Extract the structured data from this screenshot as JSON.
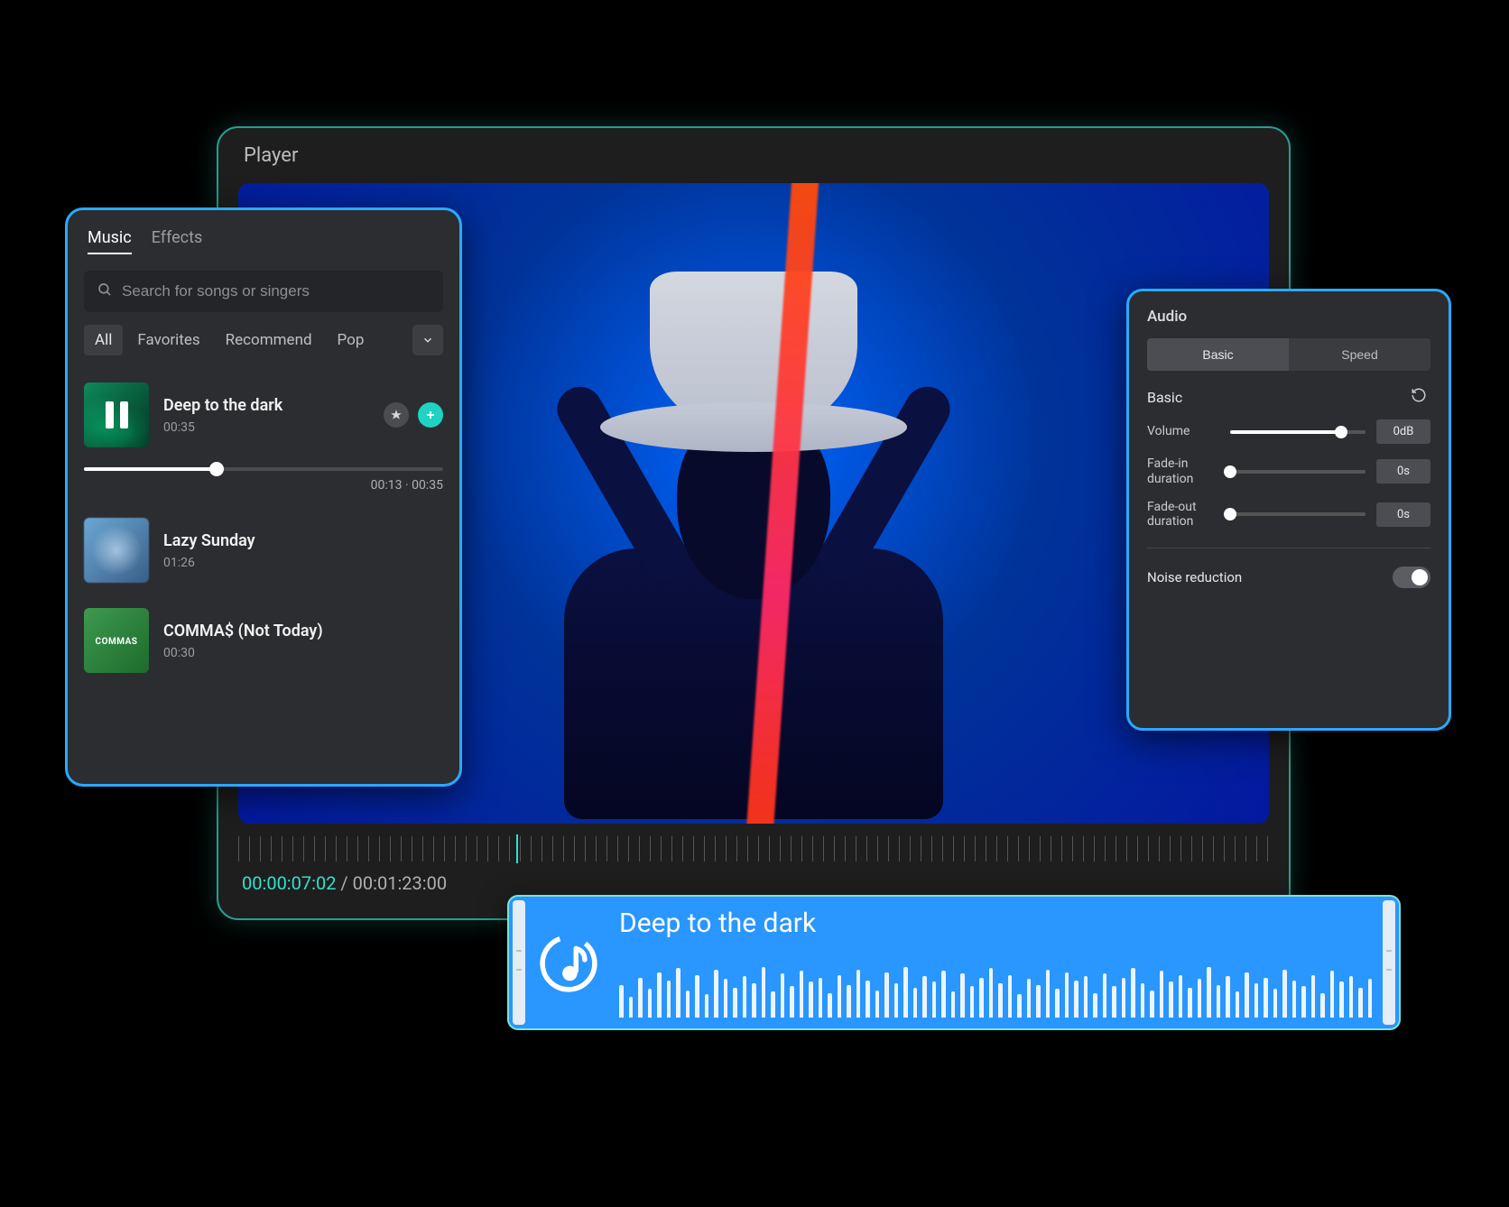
{
  "player": {
    "title": "Player",
    "timecode_current": "00:00:07:02",
    "timecode_total": "00:01:23:00",
    "timecode_sep": " / "
  },
  "musicPanel": {
    "tabs": {
      "music": "Music",
      "effects": "Effects"
    },
    "search_placeholder": "Search for songs or singers",
    "filters": {
      "all": "All",
      "favorites": "Favorites",
      "recommend": "Recommend",
      "pop": "Pop"
    },
    "tracks": [
      {
        "title": "Deep to the dark",
        "duration": "00:35",
        "progress_label": "00:13 · 00:35",
        "playing": true
      },
      {
        "title": "Lazy Sunday",
        "duration": "01:26"
      },
      {
        "title": "COMMA$ (Not Today)",
        "duration": "00:30",
        "thumb_label": "COMMAS"
      }
    ]
  },
  "audioPanel": {
    "title": "Audio",
    "seg": {
      "basic": "Basic",
      "speed": "Speed"
    },
    "section_basic": "Basic",
    "volume_label": "Volume",
    "volume_value": "0dB",
    "fadein_label": "Fade-in duration",
    "fadein_value": "0s",
    "fadeout_label": "Fade-out duration",
    "fadeout_value": "0s",
    "noise_label": "Noise reduction"
  },
  "clip": {
    "title": "Deep to the dark"
  }
}
